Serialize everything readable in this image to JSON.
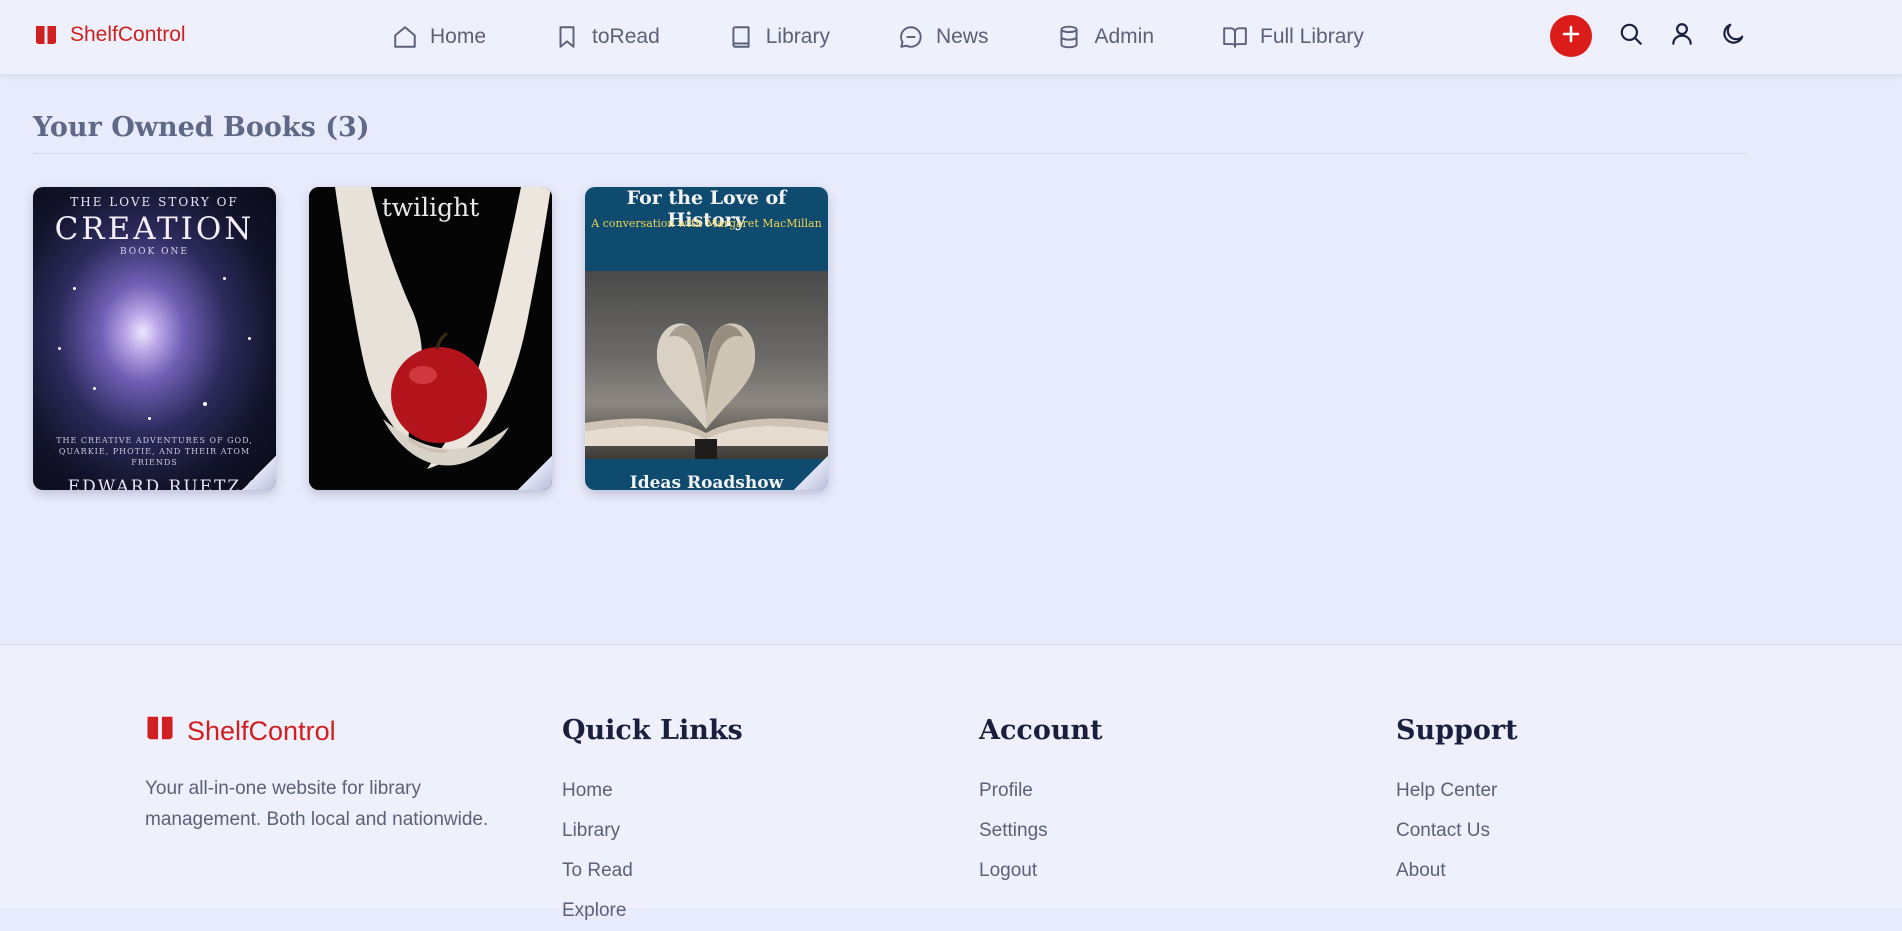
{
  "app": {
    "brand": "ShelfControl",
    "brand_color": "#d11f1f",
    "accent_color": "#dc1b1b"
  },
  "nav": {
    "items": [
      {
        "label": "Home",
        "icon": "home-icon"
      },
      {
        "label": "toRead",
        "icon": "bookmark-icon"
      },
      {
        "label": "Library",
        "icon": "book-icon"
      },
      {
        "label": "News",
        "icon": "chat-bubble-icon"
      },
      {
        "label": "Admin",
        "icon": "database-icon"
      },
      {
        "label": "Full Library",
        "icon": "open-book-icon"
      }
    ],
    "actions": [
      "add-icon",
      "search-icon",
      "user-icon",
      "moon-icon"
    ]
  },
  "main": {
    "section_title": "Your Owned Books (3)",
    "books": [
      {
        "cover_top": "THE LOVE STORY OF",
        "cover_title": "CREATION",
        "cover_series": "BOOK ONE",
        "cover_tagline": "THE CREATIVE ADVENTURES OF GOD, QUARKIE, PHOTIE, AND THEIR ATOM FRIENDS",
        "cover_author": "EDWARD RUETZ"
      },
      {
        "cover_title": "twilight"
      },
      {
        "cover_title": "For the Love of History",
        "cover_subtitle": "A conversation with Margaret MacMillan",
        "cover_bottom": "Ideas Roadshow"
      }
    ]
  },
  "footer": {
    "brand": "ShelfControl",
    "description": "Your all-in-one website for library management. Both local and nationwide.",
    "columns": [
      {
        "heading": "Quick Links",
        "links": [
          "Home",
          "Library",
          "To Read",
          "Explore"
        ]
      },
      {
        "heading": "Account",
        "links": [
          "Profile",
          "Settings",
          "Logout"
        ]
      },
      {
        "heading": "Support",
        "links": [
          "Help Center",
          "Contact Us",
          "About"
        ]
      }
    ]
  }
}
